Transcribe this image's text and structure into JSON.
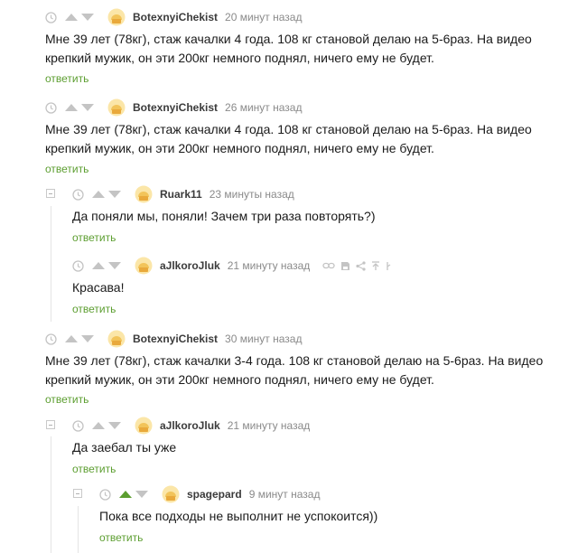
{
  "reply_label": "ответить",
  "comments": [
    {
      "author": "BotexnyiChekist",
      "time": "20 минут назад",
      "text": "Мне 39 лет (78кг), стаж качалки 4 года. 108 кг становой делаю на 5-6раз. На видео крепкий мужик, он эти 200кг немного поднял, ничего ему не будет."
    },
    {
      "author": "BotexnyiChekist",
      "time": "26 минут назад",
      "text": "Мне 39 лет (78кг), стаж качалки 4 года. 108 кг становой делаю на 5-6раз. На видео крепкий мужик, он эти 200кг немного поднял, ничего ему не будет."
    },
    {
      "author": "Ruark11",
      "time": "23 минуты назад",
      "text": "Да поняли мы, поняли! Зачем три раза повторять?)"
    },
    {
      "author": "aJlkoroJluk",
      "time": "21 минуту назад",
      "text": "Красава!"
    },
    {
      "author": "BotexnyiChekist",
      "time": "30 минут назад",
      "text": "Мне 39 лет (78кг), стаж качалки 3-4 года. 108 кг становой делаю на 5-6раз. На видео крепкий мужик, он эти 200кг немного поднял, ничего ему не будет."
    },
    {
      "author": "aJlkoroJluk",
      "time": "21 минуту назад",
      "text": "Да заебал ты уже"
    },
    {
      "author": "spagepard",
      "time": "9 минут назад",
      "text": "Пока все подходы не выполнит не успокоится))"
    }
  ],
  "icons": {
    "clock": "clock-icon",
    "upvote": "upvote-arrow-icon",
    "downvote": "downvote-arrow-icon",
    "avatar": "avatar-icon",
    "link": "link-icon",
    "save": "save-icon",
    "share": "share-icon",
    "to_parent": "to-parent-icon",
    "more": "more-icon",
    "collapse": "collapse-thread-icon"
  },
  "colors": {
    "reply": "#5c9e30",
    "upvote_active": "#5c9e30",
    "muted": "#c4c4c4"
  }
}
